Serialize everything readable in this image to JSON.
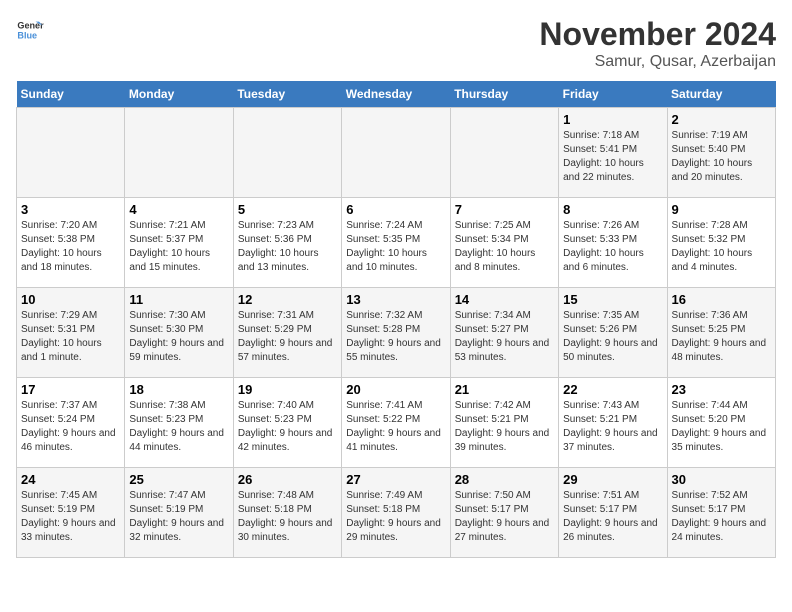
{
  "logo": {
    "line1": "General",
    "line2": "Blue"
  },
  "title": "November 2024",
  "location": "Samur, Qusar, Azerbaijan",
  "days_of_week": [
    "Sunday",
    "Monday",
    "Tuesday",
    "Wednesday",
    "Thursday",
    "Friday",
    "Saturday"
  ],
  "weeks": [
    [
      {
        "day": "",
        "info": ""
      },
      {
        "day": "",
        "info": ""
      },
      {
        "day": "",
        "info": ""
      },
      {
        "day": "",
        "info": ""
      },
      {
        "day": "",
        "info": ""
      },
      {
        "day": "1",
        "info": "Sunrise: 7:18 AM\nSunset: 5:41 PM\nDaylight: 10 hours and 22 minutes."
      },
      {
        "day": "2",
        "info": "Sunrise: 7:19 AM\nSunset: 5:40 PM\nDaylight: 10 hours and 20 minutes."
      }
    ],
    [
      {
        "day": "3",
        "info": "Sunrise: 7:20 AM\nSunset: 5:38 PM\nDaylight: 10 hours and 18 minutes."
      },
      {
        "day": "4",
        "info": "Sunrise: 7:21 AM\nSunset: 5:37 PM\nDaylight: 10 hours and 15 minutes."
      },
      {
        "day": "5",
        "info": "Sunrise: 7:23 AM\nSunset: 5:36 PM\nDaylight: 10 hours and 13 minutes."
      },
      {
        "day": "6",
        "info": "Sunrise: 7:24 AM\nSunset: 5:35 PM\nDaylight: 10 hours and 10 minutes."
      },
      {
        "day": "7",
        "info": "Sunrise: 7:25 AM\nSunset: 5:34 PM\nDaylight: 10 hours and 8 minutes."
      },
      {
        "day": "8",
        "info": "Sunrise: 7:26 AM\nSunset: 5:33 PM\nDaylight: 10 hours and 6 minutes."
      },
      {
        "day": "9",
        "info": "Sunrise: 7:28 AM\nSunset: 5:32 PM\nDaylight: 10 hours and 4 minutes."
      }
    ],
    [
      {
        "day": "10",
        "info": "Sunrise: 7:29 AM\nSunset: 5:31 PM\nDaylight: 10 hours and 1 minute."
      },
      {
        "day": "11",
        "info": "Sunrise: 7:30 AM\nSunset: 5:30 PM\nDaylight: 9 hours and 59 minutes."
      },
      {
        "day": "12",
        "info": "Sunrise: 7:31 AM\nSunset: 5:29 PM\nDaylight: 9 hours and 57 minutes."
      },
      {
        "day": "13",
        "info": "Sunrise: 7:32 AM\nSunset: 5:28 PM\nDaylight: 9 hours and 55 minutes."
      },
      {
        "day": "14",
        "info": "Sunrise: 7:34 AM\nSunset: 5:27 PM\nDaylight: 9 hours and 53 minutes."
      },
      {
        "day": "15",
        "info": "Sunrise: 7:35 AM\nSunset: 5:26 PM\nDaylight: 9 hours and 50 minutes."
      },
      {
        "day": "16",
        "info": "Sunrise: 7:36 AM\nSunset: 5:25 PM\nDaylight: 9 hours and 48 minutes."
      }
    ],
    [
      {
        "day": "17",
        "info": "Sunrise: 7:37 AM\nSunset: 5:24 PM\nDaylight: 9 hours and 46 minutes."
      },
      {
        "day": "18",
        "info": "Sunrise: 7:38 AM\nSunset: 5:23 PM\nDaylight: 9 hours and 44 minutes."
      },
      {
        "day": "19",
        "info": "Sunrise: 7:40 AM\nSunset: 5:23 PM\nDaylight: 9 hours and 42 minutes."
      },
      {
        "day": "20",
        "info": "Sunrise: 7:41 AM\nSunset: 5:22 PM\nDaylight: 9 hours and 41 minutes."
      },
      {
        "day": "21",
        "info": "Sunrise: 7:42 AM\nSunset: 5:21 PM\nDaylight: 9 hours and 39 minutes."
      },
      {
        "day": "22",
        "info": "Sunrise: 7:43 AM\nSunset: 5:21 PM\nDaylight: 9 hours and 37 minutes."
      },
      {
        "day": "23",
        "info": "Sunrise: 7:44 AM\nSunset: 5:20 PM\nDaylight: 9 hours and 35 minutes."
      }
    ],
    [
      {
        "day": "24",
        "info": "Sunrise: 7:45 AM\nSunset: 5:19 PM\nDaylight: 9 hours and 33 minutes."
      },
      {
        "day": "25",
        "info": "Sunrise: 7:47 AM\nSunset: 5:19 PM\nDaylight: 9 hours and 32 minutes."
      },
      {
        "day": "26",
        "info": "Sunrise: 7:48 AM\nSunset: 5:18 PM\nDaylight: 9 hours and 30 minutes."
      },
      {
        "day": "27",
        "info": "Sunrise: 7:49 AM\nSunset: 5:18 PM\nDaylight: 9 hours and 29 minutes."
      },
      {
        "day": "28",
        "info": "Sunrise: 7:50 AM\nSunset: 5:17 PM\nDaylight: 9 hours and 27 minutes."
      },
      {
        "day": "29",
        "info": "Sunrise: 7:51 AM\nSunset: 5:17 PM\nDaylight: 9 hours and 26 minutes."
      },
      {
        "day": "30",
        "info": "Sunrise: 7:52 AM\nSunset: 5:17 PM\nDaylight: 9 hours and 24 minutes."
      }
    ]
  ]
}
